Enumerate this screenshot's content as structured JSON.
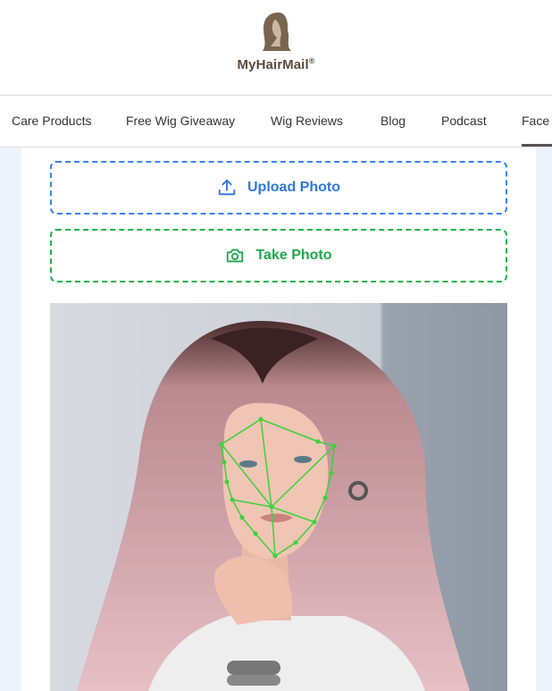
{
  "brand": {
    "name": "MyHairMail",
    "registered": "®",
    "color": "#6e5a45"
  },
  "nav": {
    "items": [
      "Care Products",
      "Free Wig Giveaway",
      "Wig Reviews",
      "Blog",
      "Podcast",
      "Face"
    ],
    "active": "Face"
  },
  "actions": {
    "upload_label": "Upload Photo",
    "take_label": "Take Photo",
    "upload_color": "#2f77dc",
    "take_color": "#1fa84a"
  },
  "photo": {
    "subject": "woman with long pink hair",
    "overlay": "face landmark mesh",
    "overlay_color": "#3cd23c"
  }
}
